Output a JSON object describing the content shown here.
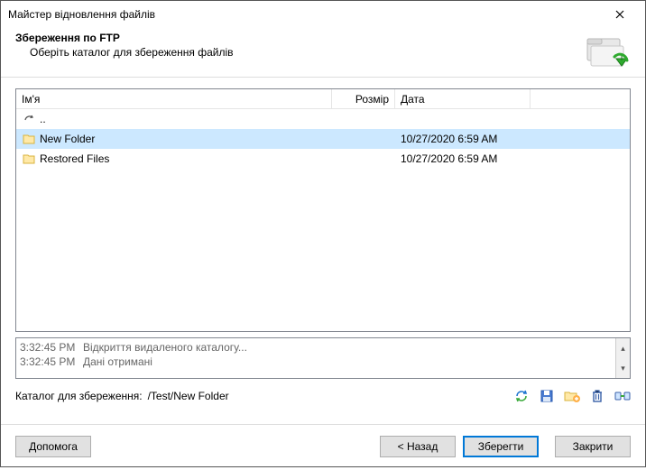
{
  "window": {
    "title": "Майстер відновлення файлів"
  },
  "header": {
    "title": "Збереження по FTP",
    "subtitle": "Оберіть каталог для збереження файлів"
  },
  "columns": {
    "name": "Ім'я",
    "size": "Розмір",
    "date": "Дата"
  },
  "up_label": "..",
  "items": [
    {
      "name": "New Folder",
      "size": "",
      "date": "10/27/2020 6:59 AM",
      "selected": true
    },
    {
      "name": "Restored Files",
      "size": "",
      "date": "10/27/2020 6:59 AM",
      "selected": false
    }
  ],
  "log": [
    {
      "time": "3:32:45 PM",
      "msg": "Відкриття видаленого каталогу..."
    },
    {
      "time": "3:32:45 PM",
      "msg": "Дані отримані"
    }
  ],
  "path": {
    "label": "Каталог для збереження:",
    "value": "/Test/New Folder"
  },
  "buttons": {
    "help": "Допомога",
    "back": "< Назад",
    "save": "Зберегти",
    "close": "Закрити"
  }
}
